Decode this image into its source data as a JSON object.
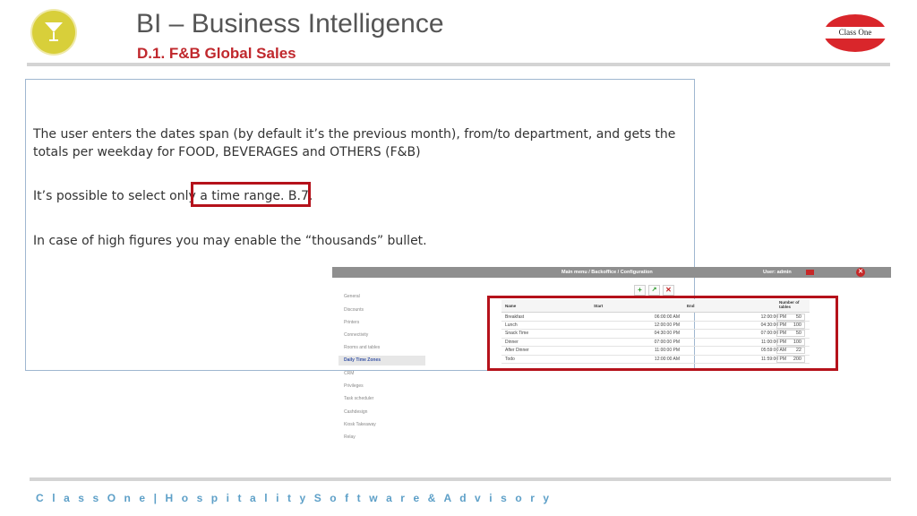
{
  "header": {
    "title": "BI – Business Intelligence",
    "subtitle": "D.1. F&B Global Sales",
    "right_logo_text": "Class One"
  },
  "body": {
    "paragraph1": "The user enters the dates span (by default it’s the previous month), from/to department, and gets the totals per weekday for FOOD, BEVERAGES and OTHERS (F&B)",
    "paragraph2": "It’s possible to select only a time range. B.7.",
    "paragraph3": "In case of high figures you may enable the “thousands” bullet."
  },
  "app": {
    "breadcrumb": "Main menu /  Backoffice /  Configuration",
    "user": "User: admin",
    "sidebar": [
      "General",
      "Discounts",
      "Printers",
      "Connectivity",
      "Rooms and tables",
      "Daily Time Zones",
      "CRM",
      "Privileges",
      "Task scheduler",
      "Cashdesign",
      "Kiosk Takeaway",
      "Relay"
    ],
    "active_item": "Daily Time Zones",
    "table": {
      "headers": [
        "Name",
        "Start",
        "End",
        "Number of tables"
      ],
      "rows": [
        {
          "name": "Breakfast",
          "start": "06:00:00 AM",
          "end": "12:00:00 PM",
          "tables": "50"
        },
        {
          "name": "Lunch",
          "start": "12:00:00 PM",
          "end": "04:30:00 PM",
          "tables": "100"
        },
        {
          "name": "Snack Time",
          "start": "04:30:00 PM",
          "end": "07:00:00 PM",
          "tables": "50"
        },
        {
          "name": "Dinner",
          "start": "07:00:00 PM",
          "end": "11:00:00 PM",
          "tables": "100"
        },
        {
          "name": "After Dinner",
          "start": "11:00:00 PM",
          "end": "05:59:00 AM",
          "tables": "22"
        },
        {
          "name": "Todo",
          "start": "12:00:00 AM",
          "end": "11:59:00 PM",
          "tables": "200"
        }
      ]
    }
  },
  "footer": {
    "text": "C l a s s O n e | H o s p i t a l i t y S o f t w a r e & A d v i s o r y"
  },
  "colors": {
    "title_gray": "#555555",
    "subtitle_red": "#c0282d",
    "highlight_red": "#b5121b",
    "footer_blue": "#5ea0c8"
  }
}
